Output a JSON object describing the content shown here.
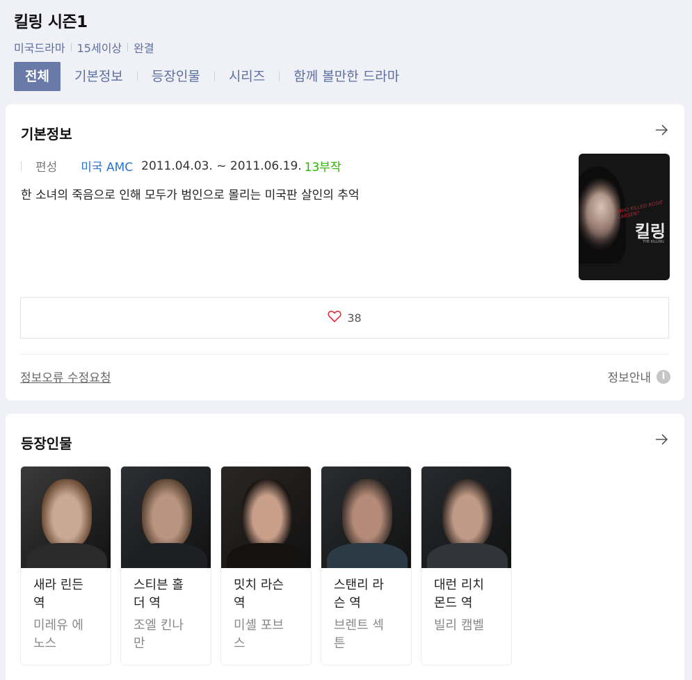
{
  "header": {
    "title": "킬링 시즌1",
    "meta": [
      "미국드라마",
      "15세이상",
      "완결"
    ]
  },
  "tabs": [
    "전체",
    "기본정보",
    "등장인물",
    "시리즈",
    "함께 볼만한 드라마"
  ],
  "basic_info": {
    "title": "기본정보",
    "label": "편성",
    "network": "미국 AMC",
    "dates": "2011.04.03. ~ 2011.06.19.",
    "episodes": "13부작",
    "description": "한 소녀의 죽음으로 인해 모두가 범인으로 몰리는 미국판 살인의 추억",
    "likes": "38",
    "edit_link": "정보오류 수정요청",
    "info_guide": "정보안내",
    "poster": {
      "logo": "킬링",
      "logo_sub": "THE KILLING",
      "tagline": "WHO KILLED ROSIE LARSEN?"
    }
  },
  "cast": {
    "title": "등장인물",
    "members": [
      {
        "role_line1": "새라 린든",
        "role_line2": "역",
        "actor_line1": "미레유 에",
        "actor_line2": "노스",
        "skin": "#c9a894",
        "hair": "#6b4a33",
        "bg": "#3a3a3a",
        "cloth": "#2a2a2a"
      },
      {
        "role_line1": "스티븐 홀",
        "role_line2": "더 역",
        "actor_line1": "조엘 킨나",
        "actor_line2": "만",
        "skin": "#b89580",
        "hair": "#5a4332",
        "bg": "#2c2f33",
        "cloth": "#1d1f22"
      },
      {
        "role_line1": "밋치 라슨",
        "role_line2": "역",
        "actor_line1": "미셸 포브",
        "actor_line2": "스",
        "skin": "#c8a08a",
        "hair": "#1b1411",
        "bg": "#2a2623",
        "cloth": "#141210"
      },
      {
        "role_line1": "스탠리 라",
        "role_line2": "슨 역",
        "actor_line1": "브렌트 섹",
        "actor_line2": "튼",
        "skin": "#b48a78",
        "hair": "#3a302a",
        "bg": "#2a2d30",
        "cloth": "#2c3a46"
      },
      {
        "role_line1": "대런 리치",
        "role_line2": "몬드 역",
        "actor_line1": "빌리 캠벨",
        "actor_line2": "",
        "skin": "#bf9a86",
        "hair": "#2e2520",
        "bg": "#262a2e",
        "cloth": "#31353a"
      }
    ]
  }
}
